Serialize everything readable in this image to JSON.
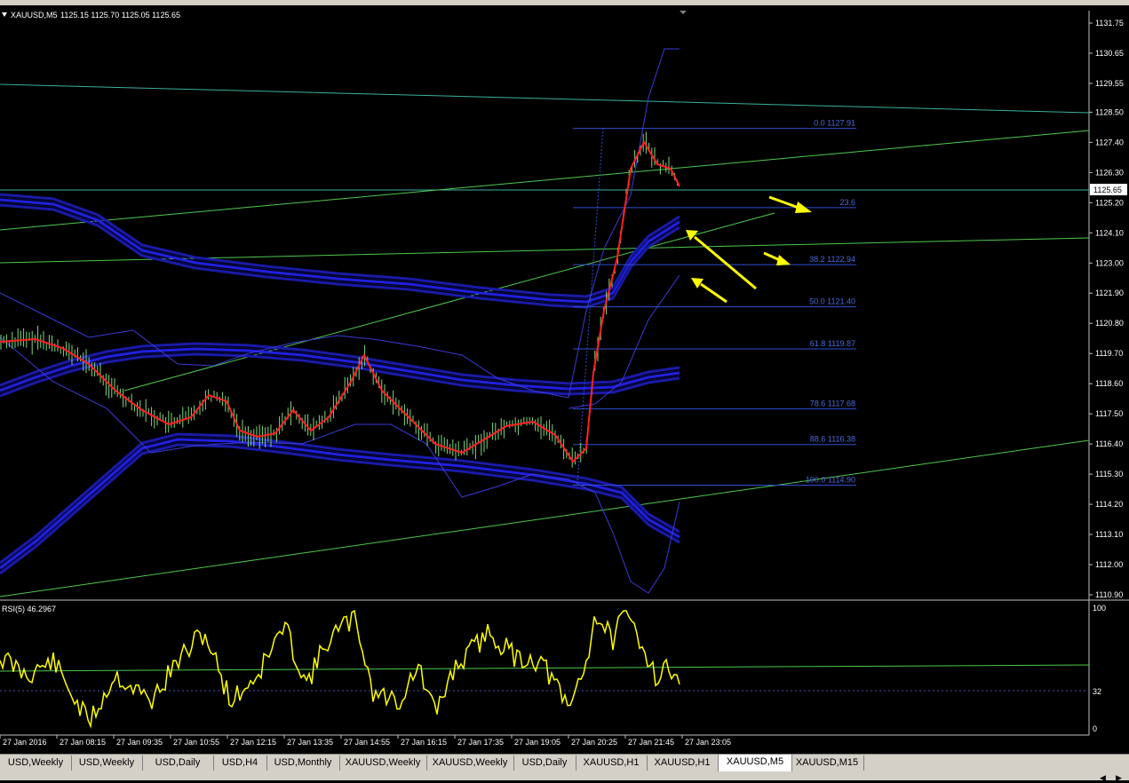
{
  "chart_header": {
    "symbol_tf": "XAUUSD,M5",
    "ohlc": "1125.15 1125.70 1125.05 1125.65"
  },
  "price_axis": {
    "ticks": [
      "1131.75",
      "1130.65",
      "1129.55",
      "1128.50",
      "1127.40",
      "1126.30",
      "1125.20",
      "1124.10",
      "1123.00",
      "1121.90",
      "1120.80",
      "1119.70",
      "1118.60",
      "1117.50",
      "1116.40",
      "1115.30",
      "1114.20",
      "1113.10",
      "1112.00",
      "1110.90"
    ],
    "current_price": "1125.65"
  },
  "fibonacci_levels": [
    {
      "label": "0.0 1127.91",
      "price": 1127.91
    },
    {
      "label": "23.6",
      "price": 1125.02
    },
    {
      "label": "38.2 1122.94",
      "price": 1122.94
    },
    {
      "label": "50.0 1121.40",
      "price": 1121.4
    },
    {
      "label": "61.8 1119.87",
      "price": 1119.87
    },
    {
      "label": "78.6 1117.68",
      "price": 1117.68
    },
    {
      "label": "88.6 1116.38",
      "price": 1116.38
    },
    {
      "label": "100.0 1114.90",
      "price": 1114.9
    }
  ],
  "rsi_panel": {
    "label": "RSI(5) 46.2967",
    "ticks": [
      "100",
      "32",
      "0"
    ]
  },
  "time_axis": {
    "ticks": [
      "27 Jan 2016",
      "27 Jan 08:15",
      "27 Jan 09:35",
      "27 Jan 10:55",
      "27 Jan 12:15",
      "27 Jan 13:35",
      "27 Jan 14:55",
      "27 Jan 16:15",
      "27 Jan 17:35",
      "27 Jan 19:05",
      "27 Jan 20:25",
      "27 Jan 21:45",
      "27 Jan 23:05"
    ]
  },
  "tabs": [
    {
      "label": "USD,Weekly"
    },
    {
      "label": "USD,Weekly"
    },
    {
      "label": "USD,Daily"
    },
    {
      "label": "USD,H4"
    },
    {
      "label": "USD,Monthly"
    },
    {
      "label": "XAUUSD,Weekly"
    },
    {
      "label": "XAUUSD,Weekly"
    },
    {
      "label": "USD,Daily"
    },
    {
      "label": "XAUUSD,H1"
    },
    {
      "label": "XAUUSD,H1"
    },
    {
      "label": "XAUUSD,M5",
      "active": true
    },
    {
      "label": "XAUUSD,M15"
    }
  ],
  "colors": {
    "background": "#000000",
    "axis_text": "#ffffff",
    "fib": "#3050d0",
    "bands": "#1a1aa8",
    "bollinger": "#3a3ad8",
    "candles": "#7cd87c",
    "ma": "#ff2020",
    "trendline": "#4ec84e",
    "channel": "#3ab0a0",
    "rsi": "#ffff00",
    "arrows": "#ffff00"
  }
}
